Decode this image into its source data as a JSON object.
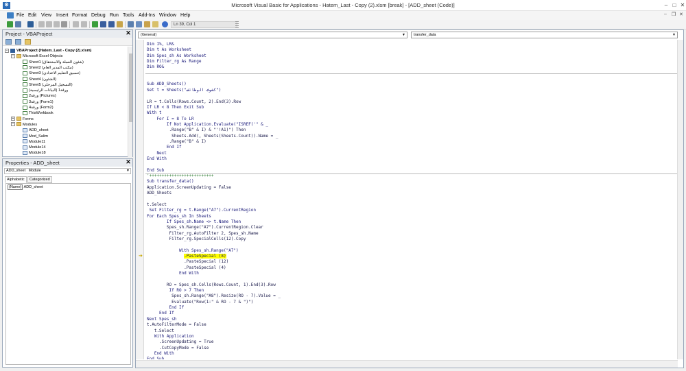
{
  "window": {
    "title": "Microsoft Visual Basic for Applications - Hatem_Last - Copy (2).xlsm [break] - [ADD_sheet (Code)]",
    "min_label": "–",
    "max_label": "□",
    "close_label": "✕"
  },
  "menu": {
    "items": [
      "File",
      "Edit",
      "View",
      "Insert",
      "Format",
      "Debug",
      "Run",
      "Tools",
      "Add-Ins",
      "Window",
      "Help"
    ],
    "mdi_min": "–",
    "mdi_restore": "❐",
    "mdi_close": "✕"
  },
  "toolbar": {
    "cursor_position": "Ln 39, Col 1"
  },
  "project": {
    "title": "Project - VBAProject",
    "close": "✕",
    "tree": [
      {
        "label": "VBAProject (Hatem_Last - Copy (2).xlsm)",
        "level": 0,
        "exp": "−",
        "icon": "project",
        "bold": true
      },
      {
        "label": "Microsoft Excel Objects",
        "level": 1,
        "exp": "−",
        "icon": "folder"
      },
      {
        "label": "Sheet1 (شئون العملة والاستحقاق)",
        "level": 2,
        "icon": "sheet"
      },
      {
        "label": "Sheet2 (مكتب المدير العام)",
        "level": 2,
        "icon": "sheet"
      },
      {
        "label": "Sheet3 (تنسيق التعليم الاعدادي)",
        "level": 2,
        "icon": "sheet"
      },
      {
        "label": "Sheet4 (الشئون)",
        "level": 2,
        "icon": "sheet"
      },
      {
        "label": "Sheet5 (التسجيل المرحلي)",
        "level": 2,
        "icon": "sheet"
      },
      {
        "label": "ورقة1 (البيانات الرئيسية)",
        "level": 2,
        "icon": "sheet"
      },
      {
        "label": "ورقة2 (Pictures)",
        "level": 2,
        "icon": "sheet"
      },
      {
        "label": "ورقة3 (Form1)",
        "level": 2,
        "icon": "sheet"
      },
      {
        "label": "ورقة4 (Form2)",
        "level": 2,
        "icon": "sheet"
      },
      {
        "label": "ThisWorkbook",
        "level": 2,
        "icon": "sheet"
      },
      {
        "label": "Forms",
        "level": 1,
        "exp": "+",
        "icon": "folder"
      },
      {
        "label": "Modules",
        "level": 1,
        "exp": "−",
        "icon": "folder"
      },
      {
        "label": "ADD_sheet",
        "level": 2,
        "icon": "module"
      },
      {
        "label": "Mod_Salim",
        "level": 2,
        "icon": "module"
      },
      {
        "label": "Module11",
        "level": 2,
        "icon": "module"
      },
      {
        "label": "Module14",
        "level": 2,
        "icon": "module"
      },
      {
        "label": "Module18",
        "level": 2,
        "icon": "module"
      }
    ]
  },
  "properties": {
    "title": "Properties - ADD_sheet",
    "close": "✕",
    "object": "ADD_sheet",
    "object_type": "Module",
    "tab_alpha": "Alphabetic",
    "tab_cat": "Categorized",
    "prop_name": "(Name)",
    "prop_value": "ADD_sheet"
  },
  "code": {
    "object_combo": "(General)",
    "proc_combo": "transfer_data",
    "lines": [
      {
        "t": "Dim I%, LR&",
        "c": "kw"
      },
      {
        "t": "Dim t As Worksheet",
        "c": "kw"
      },
      {
        "t": "Dim Spes_sh As Worksheet",
        "c": "kw"
      },
      {
        "t": "Dim Filter_rg As Range",
        "c": "kw"
      },
      {
        "t": "Dim RO&",
        "c": "kw"
      },
      {
        "t": "",
        "c": "",
        "div": true
      },
      {
        "t": "",
        "c": ""
      },
      {
        "t": "Sub ADD_Sheets()",
        "c": "kw"
      },
      {
        "t": "Set t = Sheets(\"كشوف الوظائف\")",
        "c": "kw"
      },
      {
        "t": "",
        "c": ""
      },
      {
        "t": "LR = t.Cells(Rows.Count, 2).End(3).Row",
        "c": ""
      },
      {
        "t": "If LR < 8 Then Exit Sub",
        "c": "kw"
      },
      {
        "t": "With t",
        "c": "kw"
      },
      {
        "t": "    For I = 8 To LR",
        "c": "kw"
      },
      {
        "t": "        If Not Application.Evaluate(\"ISREF('\" & _",
        "c": "kw"
      },
      {
        "t": "         .Range(\"B\" & I) & \"'!A1)\") Then",
        "c": ""
      },
      {
        "t": "          Sheets.Add(, Sheets(Sheets.Count)).Name = _",
        "c": ""
      },
      {
        "t": "         .Range(\"B\" & I)",
        "c": ""
      },
      {
        "t": "        End If",
        "c": "kw"
      },
      {
        "t": "    Next",
        "c": "kw"
      },
      {
        "t": "End With",
        "c": "kw"
      },
      {
        "t": "",
        "c": ""
      },
      {
        "t": "End Sub",
        "c": "kw",
        "div": true
      },
      {
        "t": "'++++++++++++++++++++++++++",
        "c": "cm"
      },
      {
        "t": "Sub transfer_data()",
        "c": "kw"
      },
      {
        "t": "Application.ScreenUpdating = False",
        "c": ""
      },
      {
        "t": "ADD_Sheets",
        "c": ""
      },
      {
        "t": "",
        "c": ""
      },
      {
        "t": "t.Select",
        "c": ""
      },
      {
        "t": " Set Filter_rg = t.Range(\"A7\").CurrentRegion",
        "c": "kw"
      },
      {
        "t": "For Each Spes_sh In Sheets",
        "c": "kw"
      },
      {
        "t": "        If Spes_sh.Name <> t.Name Then",
        "c": "kw"
      },
      {
        "t": "        Spes_sh.Range(\"A7\").CurrentRegion.Clear",
        "c": ""
      },
      {
        "t": "         Filter_rg.AutoFilter 2, Spes_sh.Name",
        "c": ""
      },
      {
        "t": "         Filter_rg.SpecialCells(12).Copy",
        "c": ""
      },
      {
        "t": "",
        "c": ""
      },
      {
        "t": "             With Spes_sh.Range(\"A7\")",
        "c": "kw"
      },
      {
        "t": "               .PasteSpecial (8)",
        "c": "",
        "hl": true,
        "arrow": true
      },
      {
        "t": "               .PasteSpecial (12)",
        "c": ""
      },
      {
        "t": "               .PasteSpecial (4)",
        "c": ""
      },
      {
        "t": "             End With",
        "c": "kw"
      },
      {
        "t": "",
        "c": ""
      },
      {
        "t": "        RO = Spes_sh.Cells(Rows.Count, 1).End(3).Row",
        "c": ""
      },
      {
        "t": "         If RO > 7 Then",
        "c": "kw"
      },
      {
        "t": "          Spes_sh.Range(\"A8\").Resize(RO - 7).Value = _",
        "c": ""
      },
      {
        "t": "          Evaluate(\"Row(1:\" & RO - 7 & \")\")",
        "c": ""
      },
      {
        "t": "         End If",
        "c": "kw"
      },
      {
        "t": "     End If",
        "c": "kw"
      },
      {
        "t": "Next Spes_sh",
        "c": "kw"
      },
      {
        "t": "t.AutoFilterMode = False",
        "c": ""
      },
      {
        "t": "   t.Select",
        "c": ""
      },
      {
        "t": "   With Application",
        "c": "kw"
      },
      {
        "t": "     .ScreenUpdating = True",
        "c": ""
      },
      {
        "t": "     .CutCopyMode = False",
        "c": ""
      },
      {
        "t": "   End With",
        "c": "kw"
      },
      {
        "t": "End Sub",
        "c": "kw"
      }
    ]
  }
}
